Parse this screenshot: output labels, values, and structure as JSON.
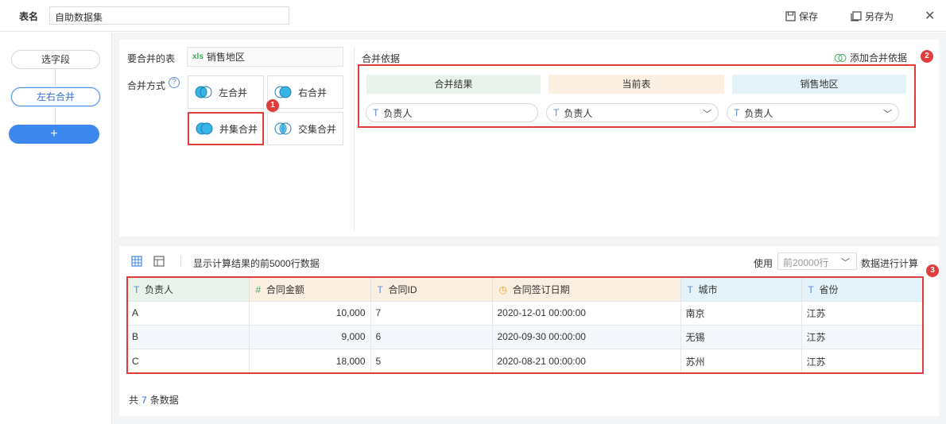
{
  "topbar": {
    "table_name_label": "表名",
    "table_name_value": "自助数据集",
    "save": "保存",
    "save_as": "另存为"
  },
  "steps": {
    "select_fields": "选字段",
    "left_right_merge": "左右合并",
    "add": "+"
  },
  "config": {
    "merge_table_label": "要合并的表",
    "merge_table_value": "销售地区",
    "merge_mode_label": "合并方式",
    "options": {
      "left": "左合并",
      "right": "右合并",
      "union": "并集合并",
      "intersect": "交集合并"
    },
    "basis_label": "合并依据",
    "add_basis": "添加合并依据",
    "basis_headers": [
      "合并结果",
      "当前表",
      "销售地区"
    ],
    "basis_fields": [
      "负责人",
      "负责人",
      "负责人"
    ]
  },
  "badges": [
    "1",
    "2",
    "3"
  ],
  "preview": {
    "text": "显示计算结果的前5000行数据",
    "use_label": "使用",
    "rows_option": "前20000行",
    "calc_label": "数据进行计算",
    "columns": [
      {
        "icon": "T",
        "name": "负责人"
      },
      {
        "icon": "#",
        "name": "合同金额"
      },
      {
        "icon": "T",
        "name": "合同ID"
      },
      {
        "icon": "clock",
        "name": "合同签订日期"
      },
      {
        "icon": "T",
        "name": "城市"
      },
      {
        "icon": "T",
        "name": "省份"
      }
    ],
    "rows": [
      [
        "A",
        "10,000",
        "7",
        "2020-12-01 00:00:00",
        "南京",
        "江苏"
      ],
      [
        "B",
        "9,000",
        "6",
        "2020-09-30 00:00:00",
        "无锡",
        "江苏"
      ],
      [
        "C",
        "18,000",
        "5",
        "2020-08-21 00:00:00",
        "苏州",
        "江苏"
      ]
    ],
    "total_prefix": "共",
    "total_count": "7",
    "total_suffix": "条数据"
  },
  "colors": {
    "accent": "#3d88ef",
    "highlight": "#e03d3d",
    "green_header": "#e9f3ec",
    "orange_header": "#fbefe1",
    "blue_header": "#e4f3fa"
  }
}
